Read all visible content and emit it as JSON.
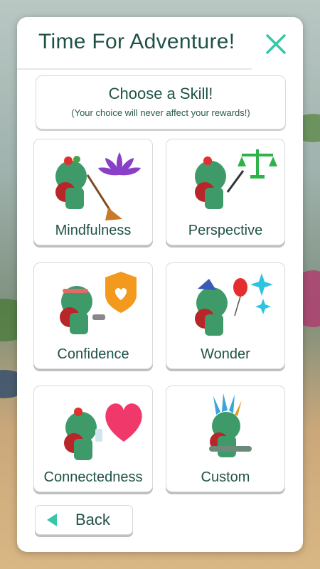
{
  "header": {
    "title": "Time For Adventure!"
  },
  "skill_prompt": {
    "heading": "Choose a Skill!",
    "subtext": "(Your choice will never affect your rewards!)"
  },
  "skills": [
    {
      "label": "Mindfulness",
      "icon": "lotus-icon",
      "color": "#8a3fc9"
    },
    {
      "label": "Perspective",
      "icon": "scales-icon",
      "color": "#2db34a"
    },
    {
      "label": "Confidence",
      "icon": "shield-heart-icon",
      "color": "#f39a1e"
    },
    {
      "label": "Wonder",
      "icon": "balloon-sparkle-icon",
      "color": "#2ec4e0"
    },
    {
      "label": "Connectedness",
      "icon": "heart-icon",
      "color": "#f0386b"
    },
    {
      "label": "Custom",
      "icon": "feather-headdress-icon",
      "color": "#3aa5d8"
    }
  ],
  "back_button": {
    "label": "Back"
  },
  "colors": {
    "accent": "#36c7a8",
    "text": "#1f5247"
  }
}
